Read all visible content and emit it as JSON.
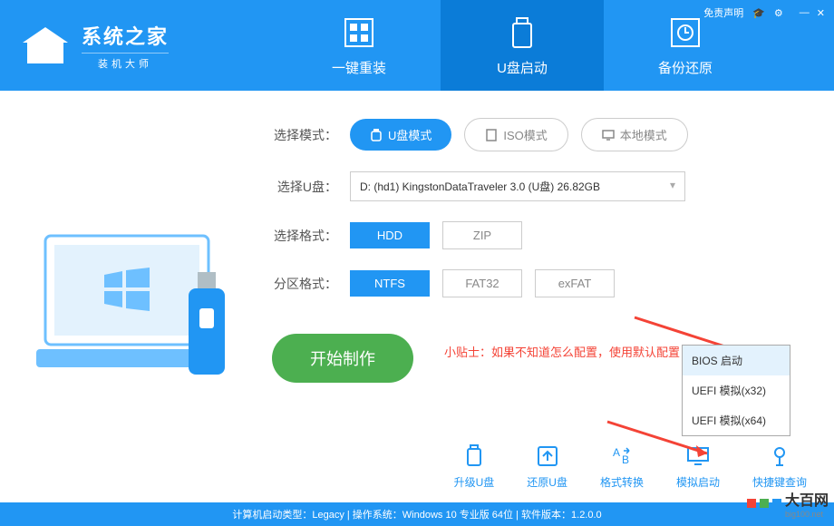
{
  "brand": {
    "title": "系统之家",
    "subtitle": "装机大师"
  },
  "topbar": {
    "disclaimer": "免责声明",
    "grad": "🎓",
    "gear": "⚙",
    "min": "—",
    "close": "✕"
  },
  "nav": {
    "reinstall": "一键重装",
    "usb_boot": "U盘启动",
    "backup": "备份还原"
  },
  "config": {
    "mode_label": "选择模式：",
    "mode_usb": "U盘模式",
    "mode_iso": "ISO模式",
    "mode_local": "本地模式",
    "drive_label": "选择U盘：",
    "drive_value": "D: (hd1) KingstonDataTraveler 3.0 (U盘) 26.82GB",
    "format_label": "选择格式：",
    "format_hdd": "HDD",
    "format_zip": "ZIP",
    "partition_label": "分区格式：",
    "fs_ntfs": "NTFS",
    "fs_fat32": "FAT32",
    "fs_exfat": "exFAT",
    "start": "开始制作",
    "tip": "小贴士：如果不知道怎么配置，使用默认配置"
  },
  "popup": {
    "bios": "BIOS 启动",
    "uefi32": "UEFI 模拟(x32)",
    "uefi64": "UEFI 模拟(x64)"
  },
  "tools": {
    "upgrade": "升级U盘",
    "restore": "还原U盘",
    "convert": "格式转换",
    "simulate": "模拟启动",
    "hotkey": "快捷键查询"
  },
  "status": "计算机启动类型：Legacy | 操作系统：Windows 10 专业版 64位 | 软件版本：1.2.0.0",
  "watermark": {
    "name": "大百网",
    "url": "big100.net"
  }
}
